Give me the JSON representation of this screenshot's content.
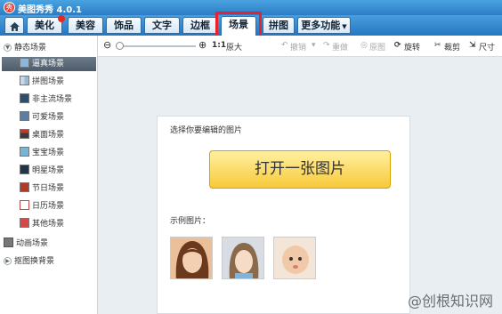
{
  "app": {
    "title": "美图秀秀 4.0.1"
  },
  "tabs": [
    {
      "label": "美化"
    },
    {
      "label": "美容"
    },
    {
      "label": "饰品"
    },
    {
      "label": "文字"
    },
    {
      "label": "边框"
    },
    {
      "label": "场景"
    },
    {
      "label": "拼图"
    },
    {
      "label": "更多功能"
    }
  ],
  "active_tab": "场景",
  "highlight_color": "#e8212c",
  "sidebar": {
    "groups": [
      {
        "label": "静态场景"
      },
      {
        "label": "动画场景"
      },
      {
        "label": "抠图换背景"
      }
    ],
    "items": [
      {
        "label": "逼真场景",
        "icon": "portrait-thumb-icon"
      },
      {
        "label": "拼图场景",
        "icon": "collage-thumb-icon"
      },
      {
        "label": "非主流场景",
        "icon": "scene-thumb-icon"
      },
      {
        "label": "可爱场景",
        "icon": "cute-thumb-icon"
      },
      {
        "label": "桌面场景",
        "icon": "desktop-thumb-icon"
      },
      {
        "label": "宝宝场景",
        "icon": "baby-thumb-icon"
      },
      {
        "label": "明星场景",
        "icon": "star-thumb-icon"
      },
      {
        "label": "节日场景",
        "icon": "holiday-thumb-icon"
      },
      {
        "label": "日历场景",
        "icon": "calendar-thumb-icon"
      },
      {
        "label": "其他场景",
        "icon": "heart-thumb-icon"
      }
    ]
  },
  "toolbar": {
    "zoom_ratio": "1:1",
    "original_size": "原大",
    "undo": "撤销",
    "redo": "重做",
    "original_image": "原图",
    "rotate": "旋转",
    "crop": "裁剪",
    "size": "尺寸"
  },
  "main": {
    "prompt": "选择你要编辑的图片",
    "open_button": "打开一张图片",
    "examples_label": "示例图片："
  },
  "watermark": "@创根知识网"
}
